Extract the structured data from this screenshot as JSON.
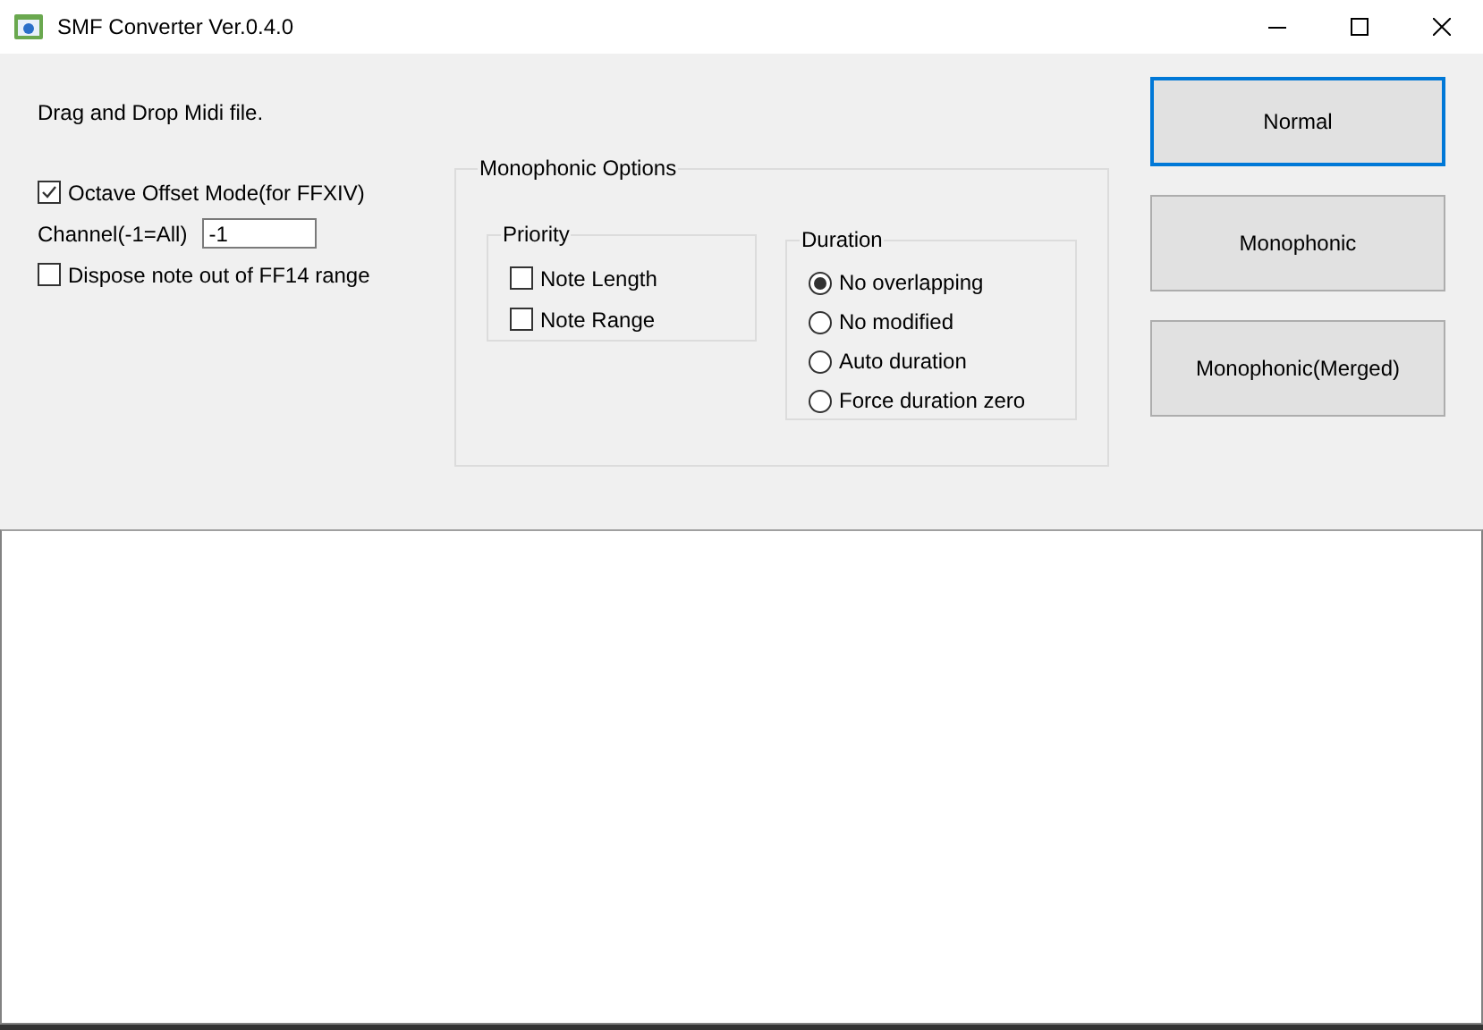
{
  "window": {
    "title": "SMF Converter Ver.0.4.0"
  },
  "hint": "Drag and Drop Midi file.",
  "options": {
    "octave_offset": {
      "label": "Octave Offset Mode(for FFXIV)",
      "checked": true
    },
    "channel": {
      "label": "Channel(-1=All)",
      "value": "-1"
    },
    "dispose": {
      "label": "Dispose note out of FF14 range",
      "checked": false
    }
  },
  "monophonic_options": {
    "title": "Monophonic Options",
    "priority": {
      "title": "Priority",
      "items": [
        {
          "label": "Note Length",
          "checked": false
        },
        {
          "label": "Note Range",
          "checked": false
        }
      ]
    },
    "duration": {
      "title": "Duration",
      "items": [
        {
          "label": "No overlapping",
          "selected": true
        },
        {
          "label": "No modified",
          "selected": false
        },
        {
          "label": "Auto duration",
          "selected": false
        },
        {
          "label": "Force duration zero",
          "selected": false
        }
      ]
    }
  },
  "buttons": [
    {
      "label": "Normal",
      "focused": true
    },
    {
      "label": "Monophonic",
      "focused": false
    },
    {
      "label": "Monophonic(Merged)",
      "focused": false
    }
  ]
}
